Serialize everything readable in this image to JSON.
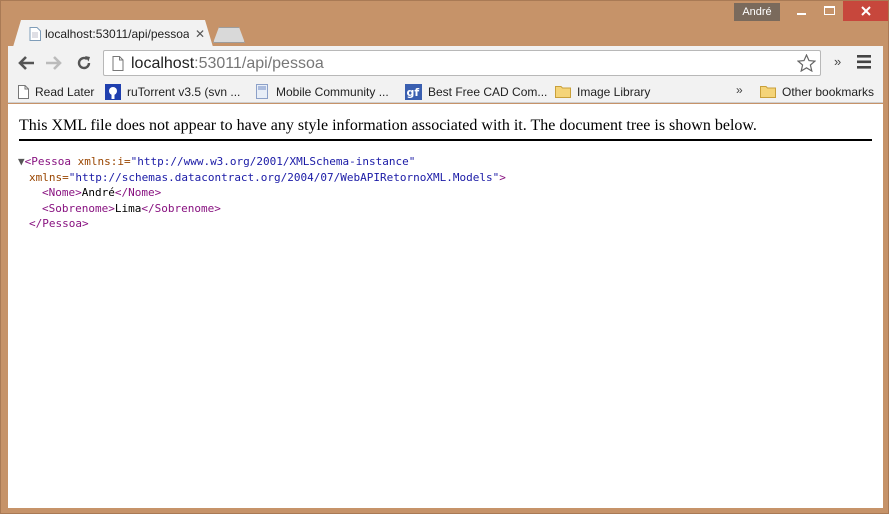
{
  "window": {
    "user_name": "André",
    "close_color": "#c7473c"
  },
  "tabs": [
    {
      "title": "localhost:53011/api/pessoa",
      "close_icon": "close-icon"
    }
  ],
  "toolbar": {
    "url_host": "localhost",
    "url_path": ":53011/api/pessoa",
    "overflow_label": "»"
  },
  "bookmarks": {
    "items": [
      {
        "label": "Read Later",
        "icon": "page-icon"
      },
      {
        "label": "ruTorrent v3.5 (svn ...",
        "icon": "rutorrent-icon"
      },
      {
        "label": "Mobile Community ...",
        "icon": "page-icon"
      },
      {
        "label": "Best Free CAD Com...",
        "icon": "gf-icon"
      },
      {
        "label": "Image Library",
        "icon": "folder-icon"
      }
    ],
    "more_label": "»",
    "other_label": "Other bookmarks"
  },
  "content": {
    "notice": "This XML file does not appear to have any style information associated with it. The document tree is shown below.",
    "xml": {
      "toggle": "▼",
      "root_open": "<Pessoa",
      "attr1_name": "xmlns:i",
      "attr1_value": "\"http://www.w3.org/2001/XMLSchema-instance\"",
      "attr2_name": "xmlns",
      "attr2_value": "\"http://schemas.datacontract.org/2004/07/WebAPIRetornoXML.Models\"",
      "root_open_close": ">",
      "nome_open": "<Nome>",
      "nome_value": "André",
      "nome_close": "</Nome>",
      "sobrenome_open": "<Sobrenome>",
      "sobrenome_value": "Lima",
      "sobrenome_close": "</Sobrenome>",
      "root_close": "</Pessoa>"
    }
  }
}
